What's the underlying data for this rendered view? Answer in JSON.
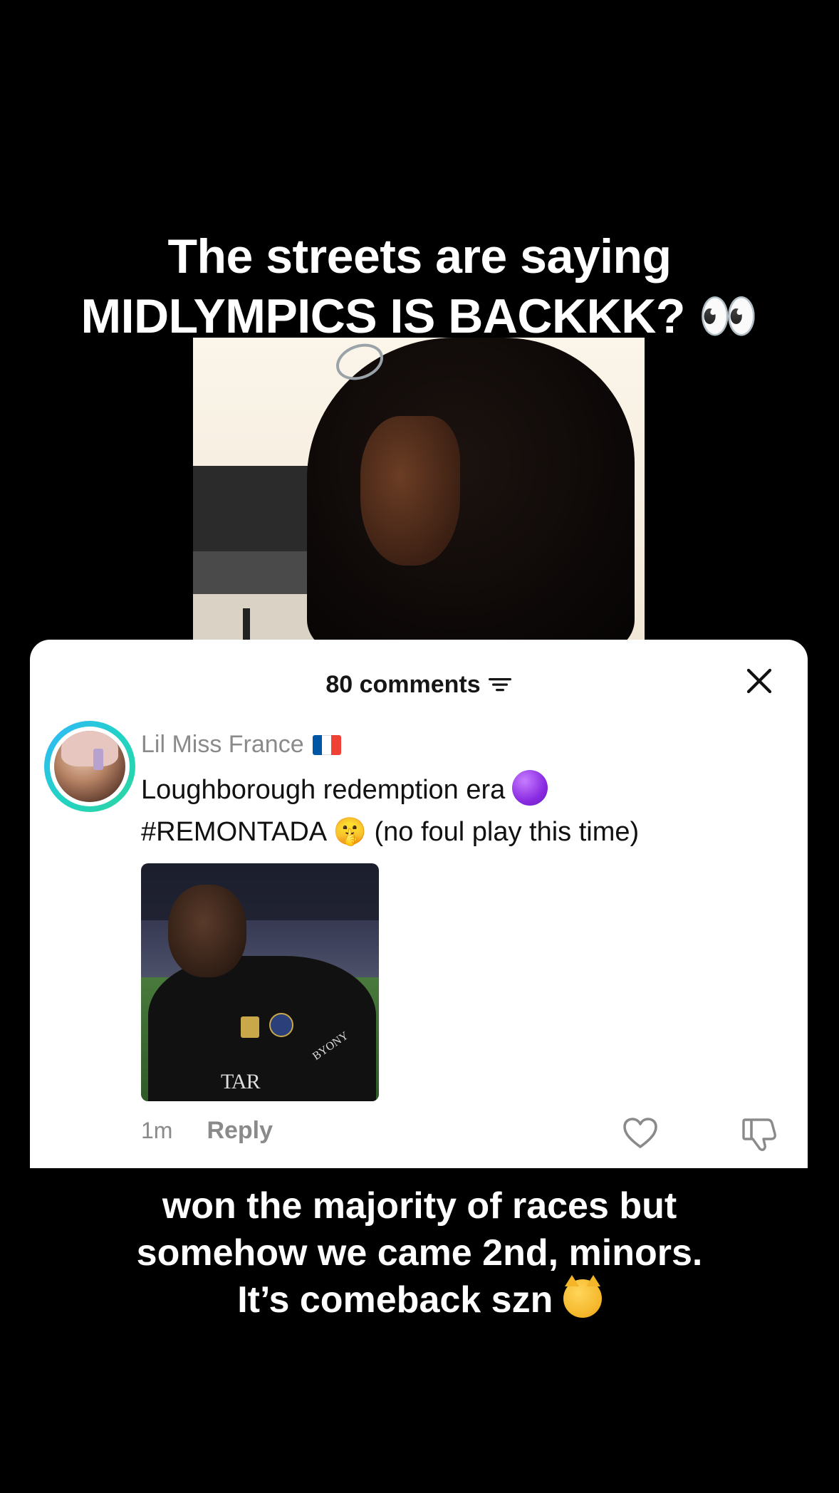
{
  "video": {
    "caption_top_line1": "The streets are saying",
    "caption_top_line2": "MIDLYMPICS IS BACKKK?",
    "caption_top_emoji": "👀",
    "caption_bottom_line1": "won the majority of races but",
    "caption_bottom_line2": "somehow we came 2nd, minors.",
    "caption_bottom_line3": "It’s comeback szn"
  },
  "comments_panel": {
    "count_label": "80 comments",
    "filter_icon": "filter-icon",
    "close_icon": "close-icon",
    "comment": {
      "username": "Lil Miss France",
      "flag": "🇫🇷",
      "flag_colors": [
        "#0055A4",
        "#FFFFFF",
        "#EF4135"
      ],
      "text_line1": "Loughborough redemption era",
      "text_line2_part1": "#REMONTADA",
      "text_line2_emoji": "🤫",
      "text_line2_part2": "(no foul play this time)",
      "gif_logo_text": "TAR",
      "gif_sleeve_text": "BYONY",
      "timestamp": "1m",
      "reply_label": "Reply"
    }
  },
  "colors": {
    "background": "#000000",
    "sheet": "#FFFFFF",
    "muted_text": "#8A8A8A",
    "avatar_ring_start": "#33B5FF",
    "avatar_ring_end": "#2DD4A0"
  }
}
